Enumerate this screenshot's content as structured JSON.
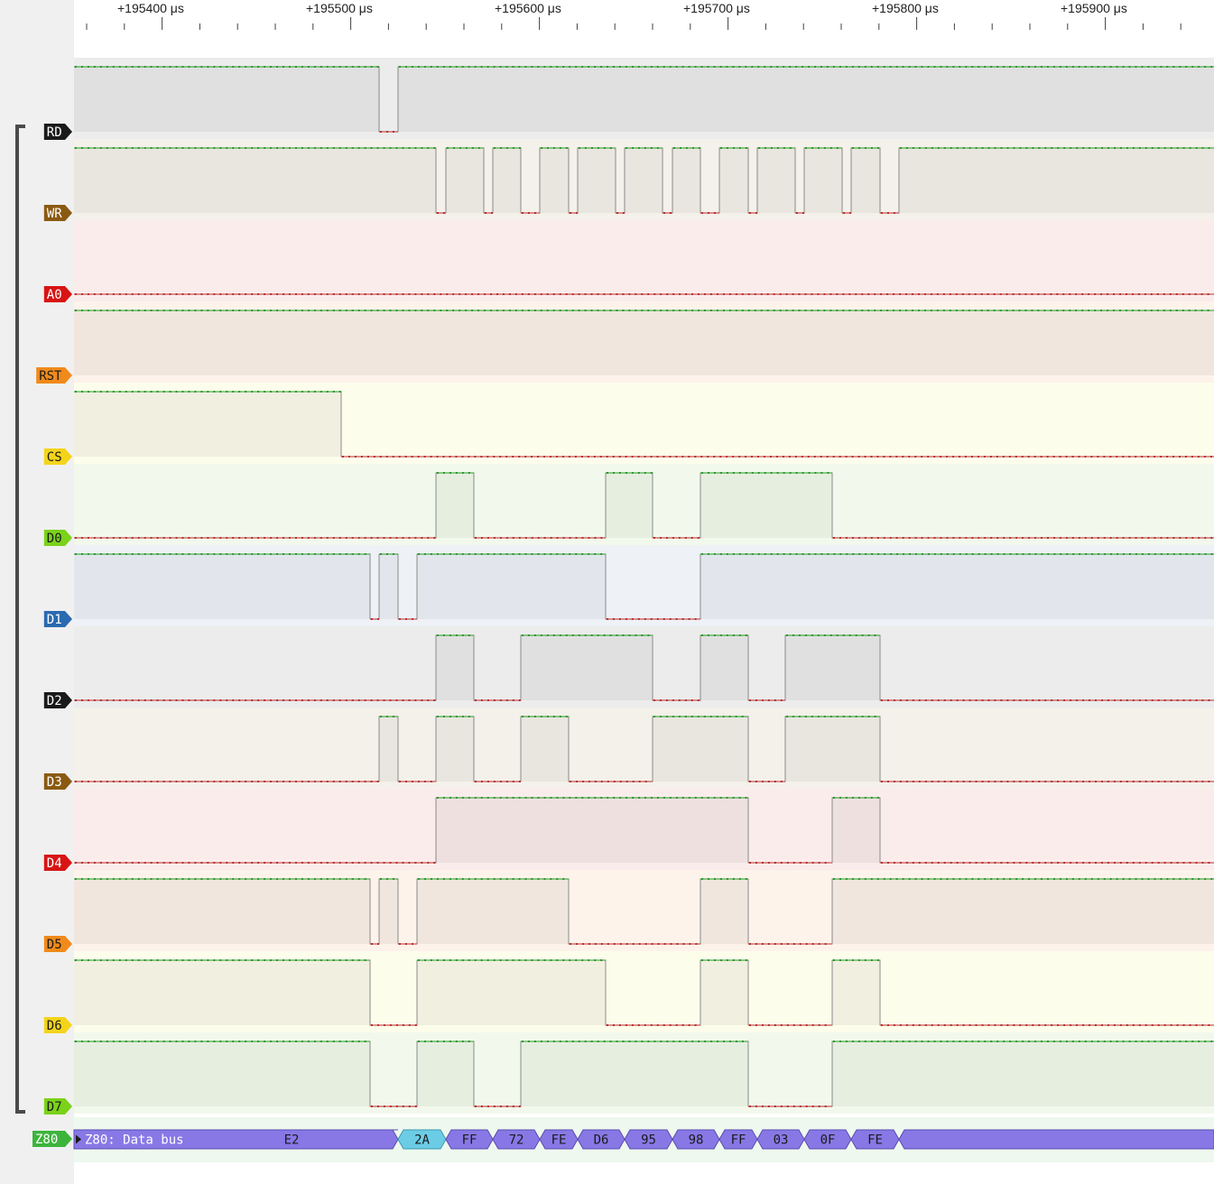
{
  "ruler": {
    "unit": "μs",
    "labels": [
      "+195400",
      "+195500",
      "+195600",
      "+195700",
      "+195800",
      "+195900"
    ]
  },
  "channels": [
    {
      "name": "RD",
      "label_color": "#1a1a1a",
      "text_color": "#ffffff",
      "bg": "#ececec",
      "fill": "#e0e0e0"
    },
    {
      "name": "WR",
      "label_color": "#8a5a12",
      "text_color": "#ffffff",
      "bg": "#f4f0ea",
      "fill": "#e9e6df"
    },
    {
      "name": "A0",
      "label_color": "#d81414",
      "text_color": "#ffffff",
      "bg": "#fbecec",
      "fill": "#efe0e0"
    },
    {
      "name": "RST",
      "label_color": "#f08a1a",
      "text_color": "#1a1a1a",
      "bg": "#fdf3ea",
      "fill": "#f0e6de"
    },
    {
      "name": "CS",
      "label_color": "#f4d41a",
      "text_color": "#1a1a1a",
      "bg": "#fdfdec",
      "fill": "#f1efe0"
    },
    {
      "name": "D0",
      "label_color": "#7ad21a",
      "text_color": "#1a1a1a",
      "bg": "#f2f9ec",
      "fill": "#e6eee0"
    },
    {
      "name": "D1",
      "label_color": "#2a6ab0",
      "text_color": "#ffffff",
      "bg": "#eef1f6",
      "fill": "#e2e6ec"
    },
    {
      "name": "D2",
      "label_color": "#1a1a1a",
      "text_color": "#ffffff",
      "bg": "#ececec",
      "fill": "#e0e0e0"
    },
    {
      "name": "D3",
      "label_color": "#8a5a12",
      "text_color": "#ffffff",
      "bg": "#f4f0ea",
      "fill": "#e9e6df"
    },
    {
      "name": "D4",
      "label_color": "#d81414",
      "text_color": "#ffffff",
      "bg": "#fbecec",
      "fill": "#efe0e0"
    },
    {
      "name": "D5",
      "label_color": "#f08a1a",
      "text_color": "#1a1a1a",
      "bg": "#fdf3ea",
      "fill": "#f0e6de"
    },
    {
      "name": "D6",
      "label_color": "#f4d41a",
      "text_color": "#1a1a1a",
      "bg": "#fdfdec",
      "fill": "#f1efe0"
    },
    {
      "name": "D7",
      "label_color": "#7ad21a",
      "text_color": "#1a1a1a",
      "bg": "#f2f9ec",
      "fill": "#e6eee0"
    }
  ],
  "decoder": {
    "channel_label": "Z80",
    "label_color": "#3cb43c",
    "row_bg": "#eef8ee",
    "annotation_color": "#8878e6",
    "highlight_color": "#6ccce6",
    "title": "Z80: Data bus",
    "values": [
      "E2",
      "2A",
      "FF",
      "72",
      "FE",
      "D6",
      "95",
      "98",
      "FF",
      "03",
      "0F",
      "FE"
    ]
  },
  "group_bracket": "channels RD–D7"
}
